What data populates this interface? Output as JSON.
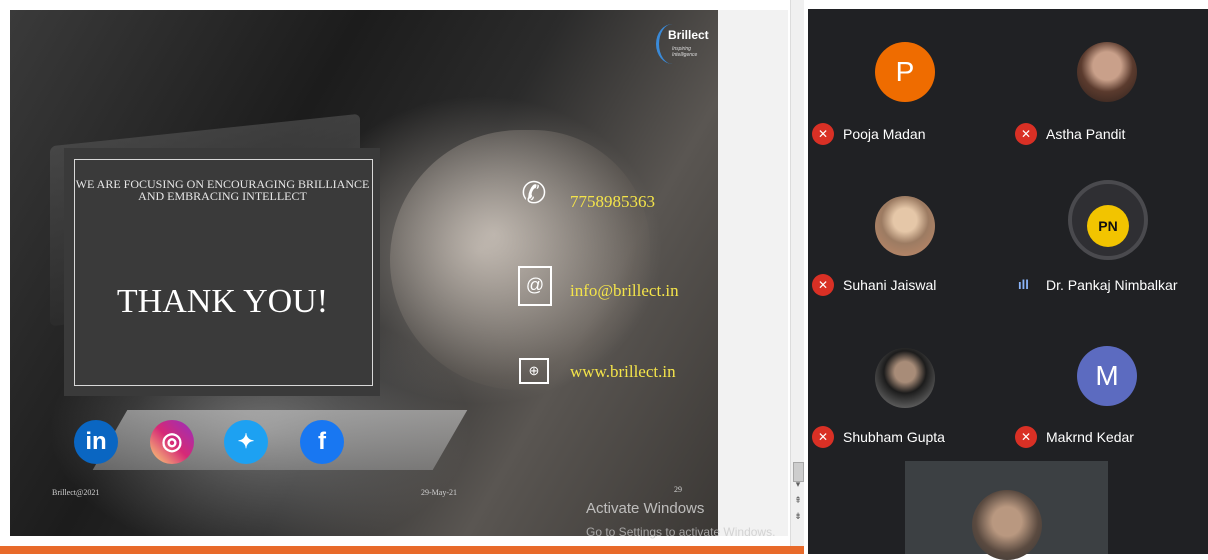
{
  "slide": {
    "brand": {
      "name": "Brillect",
      "tagline": "Inspiring Intelligence"
    },
    "message_small": "WE ARE FOCUSING ON ENCOURAGING BRILLIANCE AND EMBRACING INTELLECT",
    "message_big": "THANK YOU!",
    "contacts": {
      "phone": "7758985363",
      "email": "info@brillect.in",
      "website": "www.brillect.in"
    },
    "social": [
      {
        "name": "linkedin-icon",
        "glyph": "in",
        "color": "#0a66c2"
      },
      {
        "name": "instagram-icon",
        "glyph": "◎",
        "color": "#d6249f"
      },
      {
        "name": "twitter-icon",
        "glyph": "🐦",
        "color": "#1da1f2"
      },
      {
        "name": "facebook-icon",
        "glyph": "f",
        "color": "#1877f2"
      }
    ],
    "footer_left": "Brillect@2021",
    "footer_center": "29-May-21",
    "slide_number": "29"
  },
  "watermark": {
    "line1": "Activate Windows",
    "line2": "Go to Settings to activate Windows."
  },
  "participants": [
    {
      "name": "Pooja Madan",
      "avatar_letter": "P",
      "avatar_color": "#ef6c00",
      "muted": true
    },
    {
      "name": "Astha Pandit",
      "avatar_letter": "",
      "avatar_color": "#6d4c41",
      "muted": true
    },
    {
      "name": "Suhani Jaiswal",
      "avatar_letter": "",
      "avatar_color": "#8d6e63",
      "muted": true
    },
    {
      "name": "Dr. Pankaj Nimbalkar",
      "avatar_letter": "PN",
      "avatar_color": "#1b1b1b",
      "muted": false
    },
    {
      "name": "Shubham Gupta",
      "avatar_letter": "",
      "avatar_color": "#424242",
      "muted": true
    },
    {
      "name": "Makrnd Kedar",
      "avatar_letter": "M",
      "avatar_color": "#5c6bc0",
      "muted": true
    }
  ],
  "colors": {
    "accent": "#e86a2a",
    "muted": "#d93025",
    "contact_text": "#f4e44a"
  }
}
